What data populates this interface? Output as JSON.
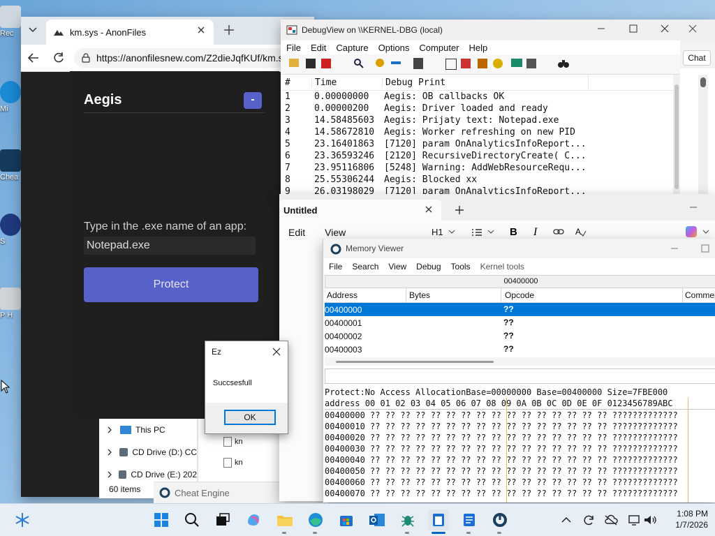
{
  "browser": {
    "tab_title": "km.sys - AnonFiles",
    "url": "https://anonfilesnew.com/Z2dieJqfKUf/km.s",
    "chat_label": "Chat"
  },
  "aegis": {
    "title": "Aegis",
    "minimize_symbol": "-",
    "prompt_label": "Type in the .exe name of an app:",
    "input_value": "Notepad.exe",
    "protect_label": "Protect"
  },
  "dialog": {
    "title": "Ez",
    "message": "Succsesfull",
    "ok_label": "OK"
  },
  "explorer": {
    "items": [
      {
        "label": "This PC"
      },
      {
        "label": "CD Drive (D:) CC"
      },
      {
        "label": "CD Drive (E:) 202"
      }
    ],
    "files": [
      "kn",
      "kn"
    ],
    "status": "60 items"
  },
  "cheat_engine_taskbar_label": "Cheat Engine",
  "debugview": {
    "title": "DebugView on \\\\KERNEL-DBG (local)",
    "menu": [
      "File",
      "Edit",
      "Capture",
      "Options",
      "Computer",
      "Help"
    ],
    "columns": [
      "#",
      "Time",
      "Debug Print"
    ],
    "rows": [
      {
        "n": "1",
        "time": "0.00000000",
        "msg": "Aegis: OB callbacks OK"
      },
      {
        "n": "2",
        "time": "0.00000200",
        "msg": "Aegis: Driver loaded and ready"
      },
      {
        "n": "3",
        "time": "14.58485603",
        "msg": "Aegis: Prijaty text: Notepad.exe"
      },
      {
        "n": "4",
        "time": "14.58672810",
        "msg": "Aegis: Worker refreshing on new PID"
      },
      {
        "n": "5",
        "time": "23.16401863",
        "msg": "[7120] param OnAnalyticsInfoReport..."
      },
      {
        "n": "6",
        "time": "23.36593246",
        "msg": "[2120] RecursiveDirectoryCreate( C..."
      },
      {
        "n": "7",
        "time": "23.95116806",
        "msg": "[5248] Warning: AddWebResourceRequ..."
      },
      {
        "n": "8",
        "time": "25.55306244",
        "msg": "Aegis: Blocked xx"
      },
      {
        "n": "9",
        "time": "26.03198029",
        "msg": "[7120] param OnAnalyticsInfoReport..."
      }
    ]
  },
  "notepad": {
    "tab_title": "Untitled",
    "menu": [
      "Edit",
      "View"
    ],
    "heading_select": "H1"
  },
  "memview": {
    "title": "Memory Viewer",
    "menu": [
      "File",
      "Search",
      "View",
      "Debug",
      "Tools",
      "Kernel tools"
    ],
    "address_bar": "00400000",
    "columns": [
      "Address",
      "Bytes",
      "Opcode",
      "Commer"
    ],
    "disasm": [
      {
        "addr": "00400000",
        "op": "??"
      },
      {
        "addr": "00400001",
        "op": "??"
      },
      {
        "addr": "00400002",
        "op": "??"
      },
      {
        "addr": "00400003",
        "op": "??"
      }
    ],
    "protect_line": "Protect:No Access  AllocationBase=00000000 Base=00400000 Size=7FBE000",
    "hex_header": "address  00 01 02 03 04 05 06 07 08 09 0A 0B 0C 0D 0E 0F 0123456789ABC",
    "hex_rows": [
      "00400000 ?? ?? ?? ?? ?? ?? ?? ?? ?? ?? ?? ?? ?? ?? ?? ?? ?????????????",
      "00400010 ?? ?? ?? ?? ?? ?? ?? ?? ?? ?? ?? ?? ?? ?? ?? ?? ?????????????",
      "00400020 ?? ?? ?? ?? ?? ?? ?? ?? ?? ?? ?? ?? ?? ?? ?? ?? ?????????????",
      "00400030 ?? ?? ?? ?? ?? ?? ?? ?? ?? ?? ?? ?? ?? ?? ?? ?? ?????????????",
      "00400040 ?? ?? ?? ?? ?? ?? ?? ?? ?? ?? ?? ?? ?? ?? ?? ?? ?????????????",
      "00400050 ?? ?? ?? ?? ?? ?? ?? ?? ?? ?? ?? ?? ?? ?? ?? ?? ?????????????",
      "00400060 ?? ?? ?? ?? ?? ?? ?? ?? ?? ?? ?? ?? ?? ?? ?? ?? ?????????????",
      "00400070 ?? ?? ?? ?? ?? ?? ?? ?? ?? ?? ?? ?? ?? ?? ?? ?? ?????????????"
    ]
  },
  "desktop_icons": [
    "Rec",
    "Mi",
    "Chea",
    "S",
    "P H"
  ],
  "clock": {
    "time": "1:08 PM",
    "date": "1/7/2026"
  },
  "colors": {
    "aegis_accent": "#5861c9",
    "selection": "#0078d7",
    "aegis_bg": "#1f1f1f"
  }
}
